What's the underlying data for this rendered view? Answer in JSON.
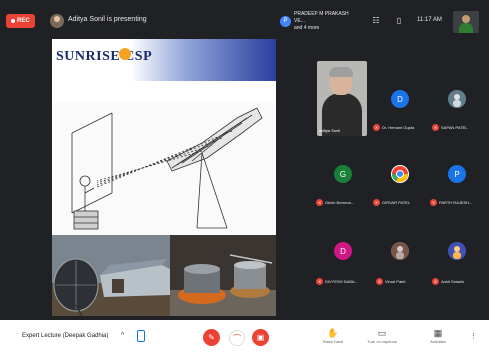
{
  "recording": {
    "label": "REC"
  },
  "presenter": {
    "text": "Aditya Sonil is presenting"
  },
  "pinned": {
    "avatar_letter": "P",
    "text_line1": "PRADEEP M PRAKASH VE...",
    "text_line2": "and 4 more"
  },
  "clock": "11:17 AM",
  "slide": {
    "brand": "SUNRISE CSP"
  },
  "participants": [
    {
      "name": "Aditya Sonil",
      "letter": "",
      "color": "",
      "muted": false
    },
    {
      "name": "Dr. Hemant Gupta",
      "letter": "D",
      "color": "#1a73e8",
      "muted": true
    },
    {
      "name": "SAPAN PATEL",
      "letter": "",
      "color": "#5f6368",
      "muted": true
    },
    {
      "name": "Girish Borrmor...",
      "letter": "G",
      "color": "#188038",
      "muted": true
    },
    {
      "name": "GIRVAR PATEL",
      "letter": "",
      "color": "#ffffff",
      "muted": true
    },
    {
      "name": "PARTH RAJESH...",
      "letter": "P",
      "color": "#1a73e8",
      "muted": true
    },
    {
      "name": "DIVYESH DABA...",
      "letter": "D",
      "color": "#d01884",
      "muted": true
    },
    {
      "name": "Vinod Patel",
      "letter": "",
      "color": "#8d6e63",
      "muted": true
    },
    {
      "name": "Ankit Solanki",
      "letter": "",
      "color": "#3949ab",
      "muted": true
    }
  ],
  "bottom": {
    "meeting_title": "Expert Lecture (Deepak Gadhia)",
    "actions": [
      {
        "icon": "hand-icon",
        "label": "Raise hand"
      },
      {
        "icon": "present-icon",
        "label": "Turn on captions"
      },
      {
        "icon": "activities-icon",
        "label": "Activities"
      }
    ]
  },
  "colors": {
    "background": "#202124",
    "danger": "#ea4335",
    "accent": "#1a73e8"
  }
}
